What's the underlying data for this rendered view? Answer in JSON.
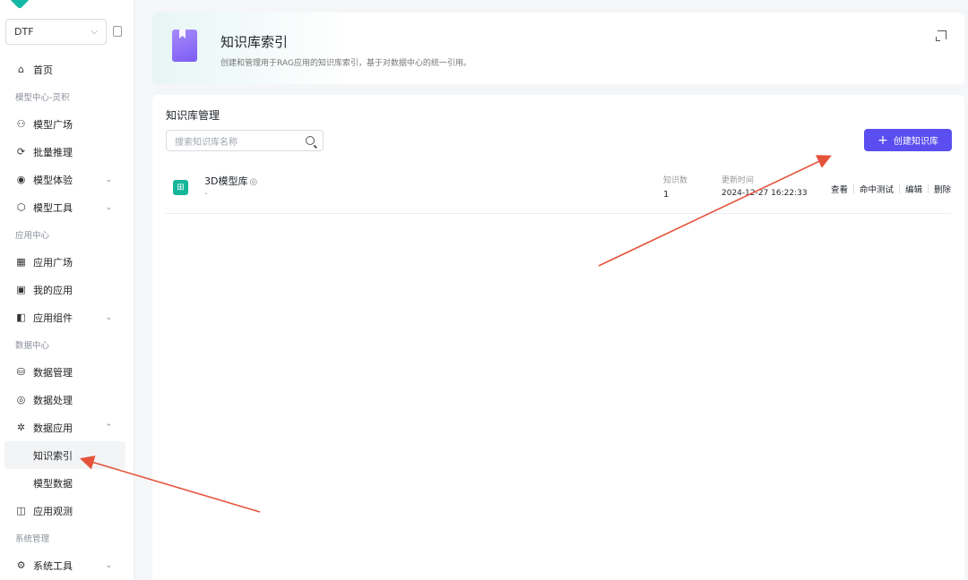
{
  "sidebar": {
    "workspace": "DTF",
    "items": [
      {
        "label": "首页",
        "icon": "home-icon"
      },
      {
        "group": "模型中心-灵积"
      },
      {
        "label": "模型广场",
        "icon": "model-square-icon"
      },
      {
        "label": "批量推理",
        "icon": "batch-icon"
      },
      {
        "label": "模型体验",
        "icon": "experience-icon",
        "expandable": true
      },
      {
        "label": "模型工具",
        "icon": "tool-icon",
        "expandable": true
      },
      {
        "group": "应用中心"
      },
      {
        "label": "应用广场",
        "icon": "grid-icon"
      },
      {
        "label": "我的应用",
        "icon": "my-app-icon"
      },
      {
        "label": "应用组件",
        "icon": "component-icon",
        "expandable": true
      },
      {
        "group": "数据中心"
      },
      {
        "label": "数据管理",
        "icon": "database-icon"
      },
      {
        "label": "数据处理",
        "icon": "process-icon"
      },
      {
        "label": "数据应用",
        "icon": "data-app-icon",
        "expanded": true
      },
      {
        "sub": "知识索引",
        "active": true
      },
      {
        "sub": "模型数据"
      },
      {
        "label": "应用观测",
        "icon": "observe-icon"
      },
      {
        "group": "系统管理"
      },
      {
        "label": "系统工具",
        "icon": "system-tool-icon",
        "expandable": true
      }
    ]
  },
  "header": {
    "title": "知识库索引",
    "description": "创建和管理用于RAG应用的知识库索引，基于对数据中心的统一引用。"
  },
  "main": {
    "section_title": "知识库管理",
    "search_placeholder": "搜索知识库名称",
    "create_button": "创建知识库",
    "rows": [
      {
        "name": "3D模型库",
        "description": "-",
        "count_label": "知识数",
        "count_value": "1",
        "time_label": "更新时间",
        "time_value": "2024-12-27 16:22:33",
        "actions": [
          "查看",
          "命中测试",
          "编辑",
          "删除"
        ]
      }
    ]
  },
  "colors": {
    "accent": "#5b4ef0",
    "kb_icon": "#16b69a",
    "annotation_arrow": "#e5533b"
  }
}
